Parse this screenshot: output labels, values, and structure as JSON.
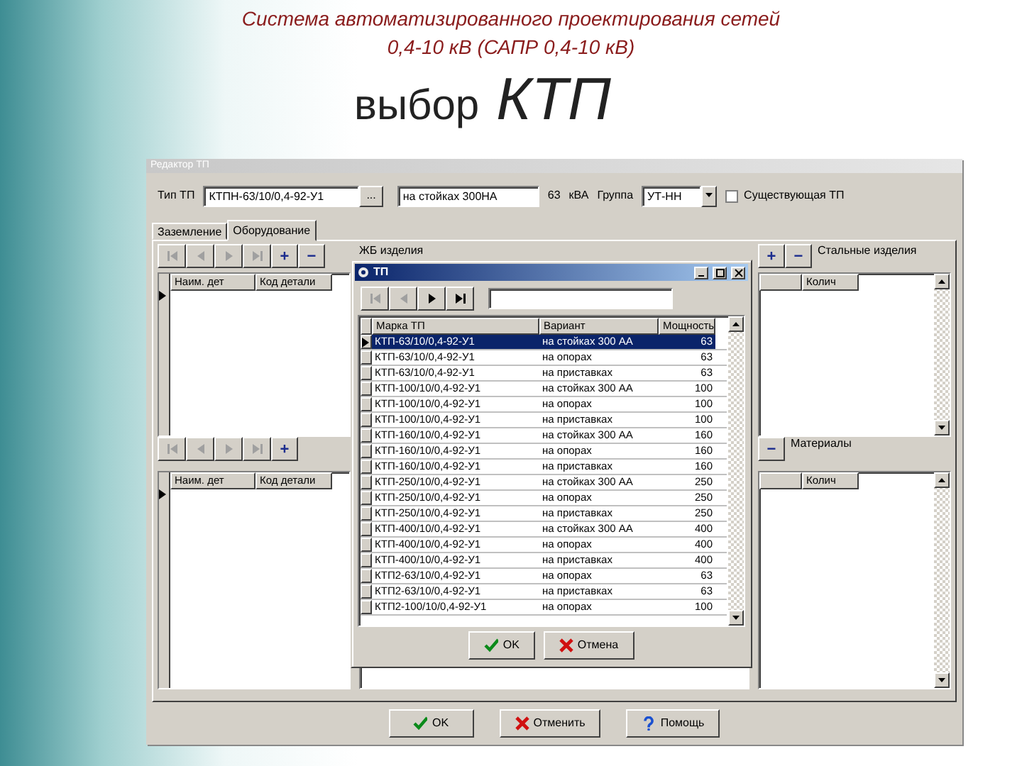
{
  "slide": {
    "title_lines": [
      "Система автоматизированного проектирования сетей",
      "0,4-10 кВ  (САПР 0,4-10 кВ)"
    ],
    "heading": "выбор",
    "heading_accent": "КТП"
  },
  "window": {
    "title": "Редактор ТП",
    "type_label": "Тип ТП",
    "type_value": "КТПН-63/10/0,4-92-У1",
    "browse": "...",
    "variant_value": "на стойках 300НА",
    "power": "63",
    "unit": "кВА",
    "group_label": "Группа",
    "group_value": "УТ-НН",
    "existing": {
      "label": "Существующая ТП",
      "checked": false
    },
    "tabs": [
      {
        "label": "Заземление",
        "selected": false
      },
      {
        "label": "Оборудование",
        "selected": true
      }
    ],
    "upper": {
      "nav": [
        {
          "kind": "first",
          "disabled": true
        },
        {
          "kind": "prev",
          "disabled": true
        },
        {
          "kind": "next",
          "disabled": true
        },
        {
          "kind": "last",
          "disabled": true
        }
      ],
      "actions": [
        "+",
        "−"
      ],
      "middle_label": "ЖБ изделия",
      "right_actions": [
        "+",
        "−"
      ],
      "right_label": "Стальные изделия",
      "left_grid": {
        "row_marker": true,
        "columns": [
          "Наим. дет",
          "Код детали"
        ]
      },
      "right_grid": {
        "row_marker": false,
        "columns": [
          "Колич"
        ]
      }
    },
    "lower": {
      "nav": [
        {
          "kind": "first",
          "disabled": true
        },
        {
          "kind": "prev",
          "disabled": true
        },
        {
          "kind": "next",
          "disabled": true
        },
        {
          "kind": "last",
          "disabled": true
        }
      ],
      "actions": [
        "+"
      ],
      "right_actions": [
        "−"
      ],
      "right_label": "Материалы",
      "left_grid": {
        "row_marker": true,
        "columns": [
          "Наим. дет",
          "Код детали"
        ]
      },
      "right_grid": {
        "row_marker": false,
        "columns": [
          "Колич"
        ]
      }
    },
    "buttons": [
      {
        "kind": "ok",
        "label": "OK"
      },
      {
        "kind": "cancel",
        "label": "Отменить"
      },
      {
        "kind": "help",
        "label": "Помощь"
      }
    ]
  },
  "dialog": {
    "title": "ТП",
    "nav": [
      {
        "kind": "first",
        "disabled": true
      },
      {
        "kind": "prev",
        "disabled": true
      },
      {
        "kind": "next",
        "disabled": false
      },
      {
        "kind": "last",
        "disabled": false
      }
    ],
    "columns": [
      "Марка ТП",
      "Вариант",
      "Мощность"
    ],
    "rows": [
      {
        "cells": [
          "КТП-63/10/0,4-92-У1",
          "на стойках 300 АА",
          "63"
        ],
        "selected": true
      },
      {
        "cells": [
          "КТП-63/10/0,4-92-У1",
          "на опорах",
          "63"
        ],
        "selected": false
      },
      {
        "cells": [
          "КТП-63/10/0,4-92-У1",
          "на приставках",
          "63"
        ],
        "selected": false
      },
      {
        "cells": [
          "КТП-100/10/0,4-92-У1",
          "на стойках 300 АА",
          "100"
        ],
        "selected": false
      },
      {
        "cells": [
          "КТП-100/10/0,4-92-У1",
          "на опорах",
          "100"
        ],
        "selected": false
      },
      {
        "cells": [
          "КТП-100/10/0,4-92-У1",
          "на приставках",
          "100"
        ],
        "selected": false
      },
      {
        "cells": [
          "КТП-160/10/0,4-92-У1",
          "на стойках 300 АА",
          "160"
        ],
        "selected": false
      },
      {
        "cells": [
          "КТП-160/10/0,4-92-У1",
          "на опорах",
          "160"
        ],
        "selected": false
      },
      {
        "cells": [
          "КТП-160/10/0,4-92-У1",
          "на приставках",
          "160"
        ],
        "selected": false
      },
      {
        "cells": [
          "КТП-250/10/0,4-92-У1",
          "на стойках 300 АА",
          "250"
        ],
        "selected": false
      },
      {
        "cells": [
          "КТП-250/10/0,4-92-У1",
          "на опорах",
          "250"
        ],
        "selected": false
      },
      {
        "cells": [
          "КТП-250/10/0,4-92-У1",
          "на приставках",
          "250"
        ],
        "selected": false
      },
      {
        "cells": [
          "КТП-400/10/0,4-92-У1",
          "на стойках 300 АА",
          "400"
        ],
        "selected": false
      },
      {
        "cells": [
          "КТП-400/10/0,4-92-У1",
          "на опорах",
          "400"
        ],
        "selected": false
      },
      {
        "cells": [
          "КТП-400/10/0,4-92-У1",
          "на приставках",
          "400"
        ],
        "selected": false
      },
      {
        "cells": [
          "КТП2-63/10/0,4-92-У1",
          "на опорах",
          "63"
        ],
        "selected": false
      },
      {
        "cells": [
          "КТП2-63/10/0,4-92-У1",
          "на приставках",
          "63"
        ],
        "selected": false
      },
      {
        "cells": [
          "КТП2-100/10/0,4-92-У1",
          "на опорах",
          "100"
        ],
        "selected": false
      }
    ],
    "buttons": [
      {
        "kind": "ok",
        "label": "OK"
      },
      {
        "kind": "cancel",
        "label": "Отмена"
      }
    ]
  }
}
